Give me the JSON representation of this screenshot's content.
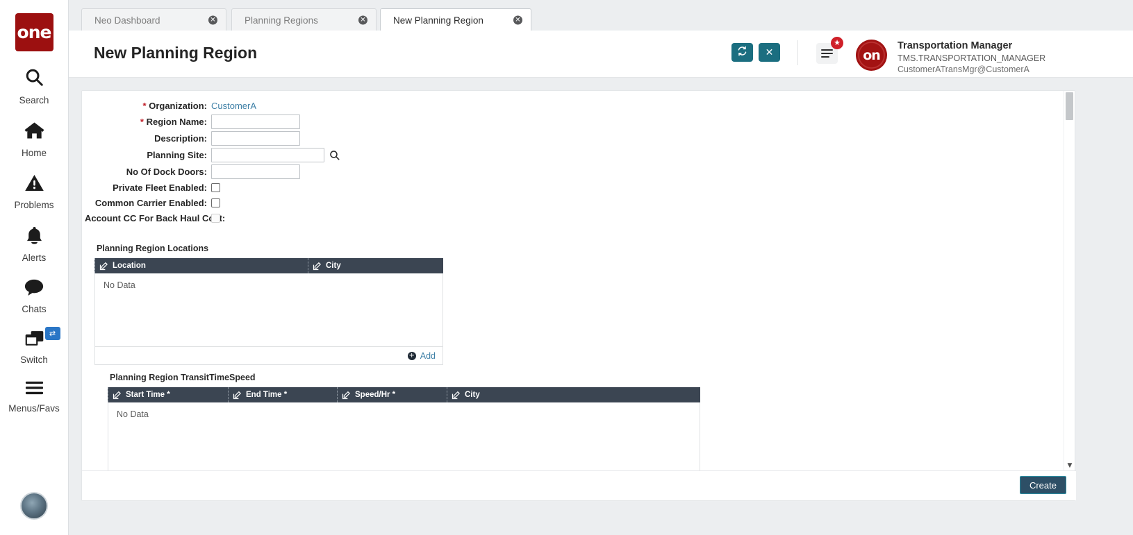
{
  "sidebar": {
    "logo_text": "one",
    "items": [
      {
        "label": "Search",
        "icon": "search-icon"
      },
      {
        "label": "Home",
        "icon": "home-icon"
      },
      {
        "label": "Problems",
        "icon": "warning-triangle-icon"
      },
      {
        "label": "Alerts",
        "icon": "bell-icon"
      },
      {
        "label": "Chats",
        "icon": "chat-bubble-icon"
      },
      {
        "label": "Switch",
        "icon": "windows-stack-icon",
        "badge_icon": "switch-arrows-icon"
      },
      {
        "label": "Menus/Favs",
        "icon": "hamburger-icon"
      }
    ]
  },
  "tabs": [
    {
      "label": "Neo Dashboard",
      "active": false,
      "close_icon": "close-circle-icon"
    },
    {
      "label": "Planning Regions",
      "active": false,
      "close_icon": "close-circle-icon"
    },
    {
      "label": "New Planning Region",
      "active": true,
      "close_icon": "close-circle-icon"
    }
  ],
  "header": {
    "title": "New Planning Region",
    "refresh_icon": "refresh-icon",
    "close_icon": "close-x-icon",
    "menu_icon": "hamburger-icon",
    "badge_icon": "star-icon",
    "avatar_text": "on",
    "user_name": "Transportation Manager",
    "user_role": "TMS.TRANSPORTATION_MANAGER",
    "user_email": "CustomerATransMgr@CustomerA",
    "chevron_icon": "chevron-down-icon"
  },
  "form": {
    "organization": {
      "label": "Organization:",
      "required": true,
      "value": "CustomerA"
    },
    "region_name": {
      "label": "Region Name:",
      "required": true,
      "value": "",
      "placeholder": ""
    },
    "description": {
      "label": "Description:",
      "required": false,
      "value": "",
      "placeholder": ""
    },
    "planning_site": {
      "label": "Planning Site:",
      "required": false,
      "value": "",
      "placeholder": "",
      "search_icon": "search-icon"
    },
    "dock_doors": {
      "label": "No Of Dock Doors:",
      "required": false,
      "value": "",
      "placeholder": ""
    },
    "private_fleet": {
      "label": "Private Fleet Enabled:",
      "checked": false,
      "disabled": false
    },
    "common_carrier": {
      "label": "Common Carrier Enabled:",
      "checked": false,
      "disabled": false
    },
    "account_cc_backhaul": {
      "label": "Account CC For Back Haul Cost:",
      "checked": false,
      "disabled": true
    }
  },
  "locations_table": {
    "caption": "Planning Region Locations",
    "columns": [
      {
        "label": "Location",
        "icon": "edit-pencil-icon"
      },
      {
        "label": "City",
        "icon": "edit-pencil-icon"
      }
    ],
    "empty_text": "No Data",
    "rows": [],
    "add_label": "Add",
    "add_icon": "plus-circle-icon"
  },
  "transit_table": {
    "caption": "Planning Region TransitTimeSpeed",
    "columns": [
      {
        "label": "Start Time *",
        "icon": "edit-pencil-icon"
      },
      {
        "label": "End Time *",
        "icon": "edit-pencil-icon"
      },
      {
        "label": "Speed/Hr *",
        "icon": "edit-pencil-icon"
      },
      {
        "label": "City",
        "icon": "edit-pencil-icon"
      }
    ],
    "empty_text": "No Data",
    "rows": []
  },
  "footer": {
    "create_label": "Create"
  },
  "scrollbar": {
    "up_icon": "caret-up-icon",
    "down_icon": "caret-down-icon"
  },
  "colors": {
    "brand_red": "#9c1010",
    "teal_button": "#1b6e80",
    "grid_header": "#3b4552",
    "link": "#3d7fa6",
    "create_button": "#2d4f66",
    "create_border": "#2a8ca0",
    "required_star": "#c0202a",
    "badge_red": "#cf1f28",
    "switch_badge_blue": "#2a76c6"
  }
}
